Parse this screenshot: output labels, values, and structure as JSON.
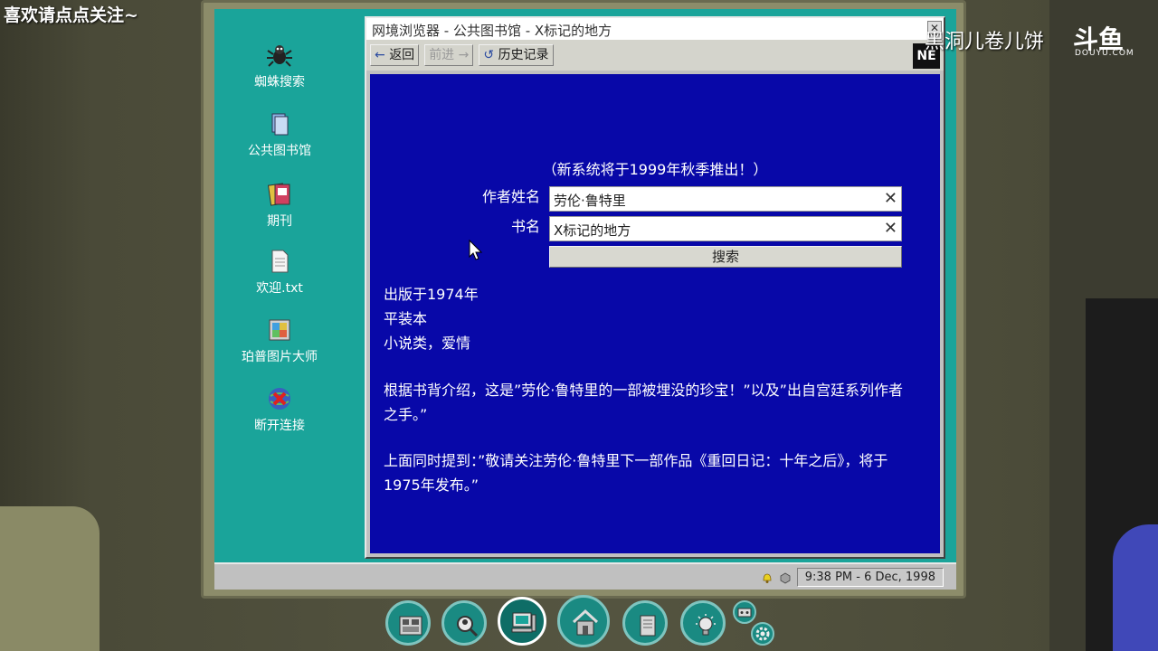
{
  "overlays": {
    "top_left": "喜欢请点点关注~",
    "top_right": "黑洞儿卷儿饼",
    "brand": "斗鱼",
    "brand_sub": "DOUYU.COM"
  },
  "desktop_icons": [
    {
      "label": "蜘蛛搜索",
      "icon": "spider-icon"
    },
    {
      "label": "公共图书馆",
      "icon": "library-book-icon"
    },
    {
      "label": "期刊",
      "icon": "magazine-icon"
    },
    {
      "label": "欢迎.txt",
      "icon": "text-file-icon"
    },
    {
      "label": "珀普图片大师",
      "icon": "image-editor-icon"
    },
    {
      "label": "断开连接",
      "icon": "disconnect-icon"
    }
  ],
  "browser": {
    "title": "网境浏览器 - 公共图书馆 - X标记的地方",
    "back_label": "返回",
    "forward_label": "前进",
    "history_label": "历史记录",
    "logo": "NE"
  },
  "page": {
    "notice": "（新系统将于1999年秋季推出！）",
    "author_label": "作者姓名",
    "author_value": "劳伦·鲁特里",
    "title_label": "书名",
    "title_value": "X标记的地方",
    "search_label": "搜索",
    "published": "出版于1974年",
    "format": "平装本",
    "genre": "小说类，爱情",
    "blurb": "根据书背介绍，这是”劳伦·鲁特里的一部被埋没的珍宝！”以及”出自宫廷系列作者之手。”",
    "mention": "上面同时提到：”敬请关注劳伦·鲁特里下一部作品《重回日记：十年之后》，将于1975年发布。”"
  },
  "taskbar": {
    "clock": "9:38 PM - 6 Dec, 1998"
  },
  "colors": {
    "desktop": "#1aa49a",
    "page_bg": "#0808a8",
    "taskbar": "#c0c0c0"
  }
}
